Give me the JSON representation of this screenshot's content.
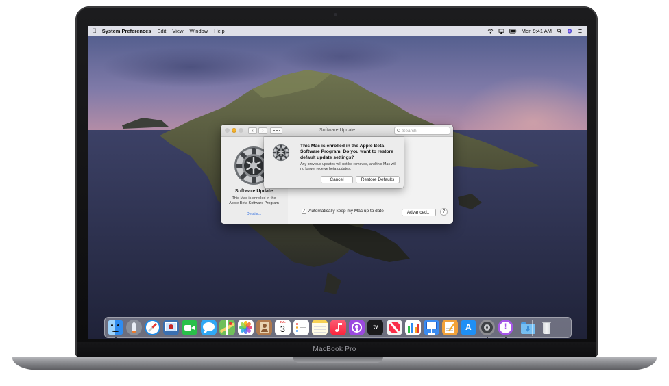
{
  "device": {
    "model_label": "MacBook Pro"
  },
  "menubar": {
    "app_name": "System Preferences",
    "menus": [
      "Edit",
      "View",
      "Window",
      "Help"
    ],
    "clock": "Mon 9:41 AM"
  },
  "window": {
    "title": "Software Update",
    "search_placeholder": "Search",
    "sidebar": {
      "title": "Software Update",
      "description": "This Mac is enrolled in the Apple Beta Software Program",
      "link": "Details..."
    },
    "auto_update_label": "Automatically keep my Mac up to date",
    "auto_update_checked": true,
    "advanced_button": "Advanced...",
    "help_button": "?"
  },
  "sheet": {
    "title": "This Mac is enrolled in the Apple Beta Software Program. Do you want to restore default update settings?",
    "body": "Any previous updates will not be removed, and this Mac will no longer receive beta updates.",
    "cancel_button": "Cancel",
    "restore_button": "Restore Defaults"
  },
  "dock": {
    "items": [
      {
        "icon": "finder-icon",
        "color": "#2f8cf0"
      },
      {
        "icon": "launchpad-icon",
        "color": "#8a8f99"
      },
      {
        "icon": "safari-icon",
        "color": "#1e88e5"
      },
      {
        "icon": "photo-booth-icon",
        "color": "#3a6fb0"
      },
      {
        "icon": "facetime-icon",
        "color": "#29c04a"
      },
      {
        "icon": "messages-icon",
        "color": "#2fa8f5"
      },
      {
        "icon": "maps-icon",
        "color": "#6fbf5a"
      },
      {
        "icon": "photos-icon",
        "color": "#f0f0f0"
      },
      {
        "icon": "contacts-icon",
        "color": "#b07a4e"
      },
      {
        "icon": "calendar-icon",
        "color": "#ffffff"
      },
      {
        "icon": "reminders-icon",
        "color": "#ffffff"
      },
      {
        "icon": "notes-icon",
        "color": "#f7d154"
      },
      {
        "icon": "music-icon",
        "color": "#fb5c74"
      },
      {
        "icon": "podcasts-icon",
        "color": "#9b49e0"
      },
      {
        "icon": "tv-icon",
        "color": "#1b1b1d"
      },
      {
        "icon": "news-icon",
        "color": "#f3f3f3"
      },
      {
        "icon": "numbers-icon",
        "color": "#ffffff"
      },
      {
        "icon": "keynote-icon",
        "color": "#3b8bf0"
      },
      {
        "icon": "pages-icon",
        "color": "#f2a13a"
      },
      {
        "icon": "app-store-icon",
        "color": "#1f8ff5"
      },
      {
        "icon": "system-preferences-icon",
        "color": "#8e8e93"
      },
      {
        "icon": "feedback-assistant-icon",
        "color": "#a455e6"
      },
      {
        "icon": "downloads-folder-icon",
        "color": "#5fb2ee"
      },
      {
        "icon": "trash-icon",
        "color": "#e6e8ea"
      }
    ],
    "calendar_month": "JUL",
    "calendar_day": "3"
  }
}
